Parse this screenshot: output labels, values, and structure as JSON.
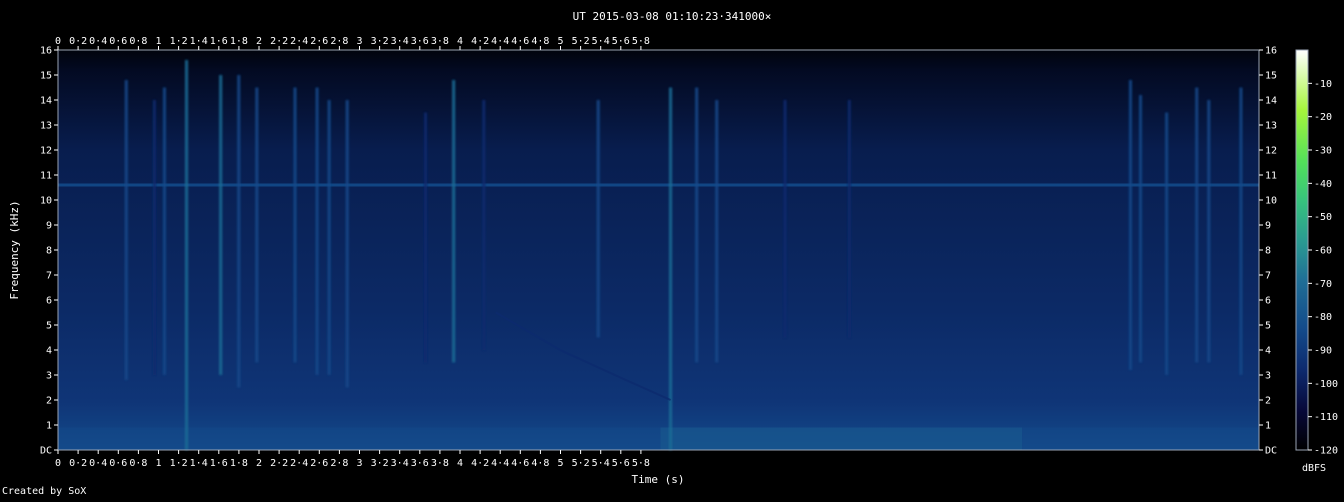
{
  "chart_data": {
    "type": "heatmap",
    "title": "UT 2015-03-08 01:10:23·341000×",
    "xlabel": "Time (s)",
    "ylabel": "Frequency (kHz)",
    "x_range": [
      0,
      5.98
    ],
    "y_range": [
      0,
      16
    ],
    "x_ticks": [
      "0",
      "0·2",
      "0·4",
      "0·6",
      "0·8",
      "1",
      "1·2",
      "1·4",
      "1·6",
      "1·8",
      "2",
      "2·2",
      "2·4",
      "2·6",
      "2·8",
      "3",
      "3·2",
      "3·4",
      "3·6",
      "3·8",
      "4",
      "4·2",
      "4·4",
      "4·6",
      "4·8",
      "5",
      "5·2",
      "5·4",
      "5·6",
      "5·8"
    ],
    "y_ticks": [
      "DC",
      "1",
      "2",
      "3",
      "4",
      "5",
      "6",
      "7",
      "8",
      "9",
      "10",
      "11",
      "12",
      "13",
      "14",
      "15",
      "16"
    ],
    "colorbar": {
      "label": "dBFS",
      "ticks": [
        "-10",
        "-20",
        "-30",
        "-40",
        "-50",
        "-60",
        "-70",
        "-80",
        "-90",
        "-100",
        "-110",
        "-120"
      ],
      "range": [
        -120,
        0
      ],
      "colors": [
        "#000000",
        "#07093a",
        "#0d2a6e",
        "#134a8a",
        "#1f6d96",
        "#2a9a92",
        "#36c27e",
        "#52e05a",
        "#a6f53c",
        "#ffffff"
      ]
    },
    "features": {
      "tone_khz": 10.6,
      "vertical_bursts": [
        {
          "t": 0.34,
          "f_low": 2.8,
          "f_high": 14.8,
          "level": -80
        },
        {
          "t": 0.48,
          "f_low": 3.0,
          "f_high": 14.0,
          "level": -88
        },
        {
          "t": 0.53,
          "f_low": 3.0,
          "f_high": 14.5,
          "level": -86
        },
        {
          "t": 0.64,
          "f_low": 0.0,
          "f_high": 15.6,
          "level": -66
        },
        {
          "t": 0.81,
          "f_low": 3.0,
          "f_high": 15.0,
          "level": -72
        },
        {
          "t": 0.9,
          "f_low": 2.5,
          "f_high": 15.0,
          "level": -82
        },
        {
          "t": 0.99,
          "f_low": 3.5,
          "f_high": 14.5,
          "level": -86
        },
        {
          "t": 1.18,
          "f_low": 3.5,
          "f_high": 14.5,
          "level": -84
        },
        {
          "t": 1.29,
          "f_low": 3.0,
          "f_high": 14.5,
          "level": -78
        },
        {
          "t": 1.35,
          "f_low": 3.0,
          "f_high": 14.0,
          "level": -80
        },
        {
          "t": 1.44,
          "f_low": 2.5,
          "f_high": 14.0,
          "level": -80
        },
        {
          "t": 1.83,
          "f_low": 3.5,
          "f_high": 13.5,
          "level": -88
        },
        {
          "t": 1.97,
          "f_low": 3.5,
          "f_high": 14.8,
          "level": -68
        },
        {
          "t": 2.12,
          "f_low": 4.0,
          "f_high": 14.0,
          "level": -88
        },
        {
          "t": 2.69,
          "f_low": 4.5,
          "f_high": 14.0,
          "level": -86
        },
        {
          "t": 3.05,
          "f_low": 0.0,
          "f_high": 14.5,
          "level": -62
        },
        {
          "t": 3.18,
          "f_low": 3.5,
          "f_high": 14.5,
          "level": -78
        },
        {
          "t": 3.28,
          "f_low": 3.5,
          "f_high": 14.0,
          "level": -82
        },
        {
          "t": 3.62,
          "f_low": 4.5,
          "f_high": 14.0,
          "level": -88
        },
        {
          "t": 3.94,
          "f_low": 4.5,
          "f_high": 14.0,
          "level": -90
        },
        {
          "t": 5.34,
          "f_low": 3.2,
          "f_high": 14.8,
          "level": -74
        },
        {
          "t": 5.39,
          "f_low": 3.5,
          "f_high": 14.2,
          "level": -78
        },
        {
          "t": 5.52,
          "f_low": 3.0,
          "f_high": 13.5,
          "level": -82
        },
        {
          "t": 5.67,
          "f_low": 3.5,
          "f_high": 14.5,
          "level": -76
        },
        {
          "t": 5.73,
          "f_low": 3.5,
          "f_high": 14.0,
          "level": -80
        },
        {
          "t": 5.89,
          "f_low": 3.0,
          "f_high": 14.5,
          "level": -84
        }
      ],
      "chirp": [
        {
          "t": 2.18,
          "f": 5.5
        },
        {
          "t": 2.5,
          "f": 4.0
        },
        {
          "t": 2.8,
          "f": 2.9
        },
        {
          "t": 3.05,
          "f": 2.0
        }
      ],
      "low_band": {
        "t_start": 3.0,
        "t_end": 4.8,
        "f_khz": 0.4,
        "level": -64
      }
    }
  },
  "footer": {
    "credit": "Created by SoX"
  }
}
